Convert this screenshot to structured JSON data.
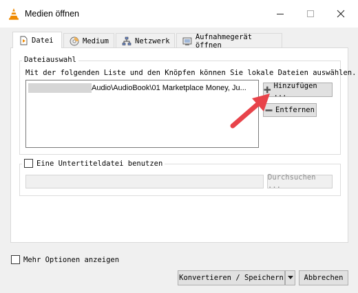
{
  "window": {
    "title": "Medien öffnen",
    "title_icon": "vlc-cone-icon",
    "buttons": {
      "minimize": "minimize-icon",
      "maximize": "maximize-icon",
      "close": "close-icon"
    }
  },
  "tabs": [
    {
      "label": "Datei",
      "icon": "file-icon",
      "active": true
    },
    {
      "label": "Medium",
      "icon": "disc-icon",
      "active": false
    },
    {
      "label": "Netzwerk",
      "icon": "network-icon",
      "active": false
    },
    {
      "label": "Aufnahmegerät öffnen",
      "icon": "capture-device-icon",
      "active": false
    }
  ],
  "file_selection": {
    "group_label": "Dateiauswahl",
    "description": "Mit der folgenden Liste und den Knöpfen können Sie lokale Dateien auswählen.",
    "files": [
      {
        "path_visible": "Audio\\AudioBook\\01 Marketplace Money, Ju...",
        "redacted_prefix": true
      }
    ],
    "add_button": "Hinzufügen ...",
    "remove_button": "Entfernen"
  },
  "subtitles": {
    "checkbox_label": "Eine Untertiteldatei benutzen",
    "checked": false,
    "input_value": "",
    "browse_button": "Durchsuchen ..."
  },
  "footer": {
    "more_options_label": "Mehr Optionen anzeigen",
    "more_options_checked": false,
    "convert_button": "Konvertieren / Speichern",
    "cancel_button": "Abbrechen"
  },
  "colors": {
    "annotation_arrow": "#e8434a",
    "vlc_orange": "#f08a00"
  }
}
